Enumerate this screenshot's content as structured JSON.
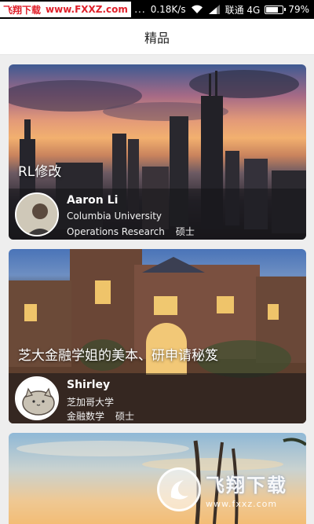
{
  "status_bar": {
    "watermark_left": "飞翔下载",
    "watermark_url": "www.FXXZ.com",
    "dots": "...",
    "speed": "0.18K/s",
    "carrier": "联通 4G",
    "battery": "79%",
    "battery_level": 0.79
  },
  "header": {
    "title": "精品"
  },
  "cards": [
    {
      "title": "RL修改",
      "name": "Aaron Li",
      "school": "Columbia University",
      "major": "Operations Research",
      "degree": "硕士"
    },
    {
      "title": "芝大金融学姐的美本、研申请秘笈",
      "name": "Shirley",
      "school": "芝加哥大学",
      "major": "金融数学",
      "degree": "硕士"
    }
  ],
  "watermark_bottom": {
    "big": "飞翔下载",
    "small": "www.fxxz.com"
  },
  "colors": {
    "status_bg": "#000000",
    "watermark_red": "#e0202a",
    "header_bg": "#ffffff",
    "page_bg": "#eeeeee"
  }
}
